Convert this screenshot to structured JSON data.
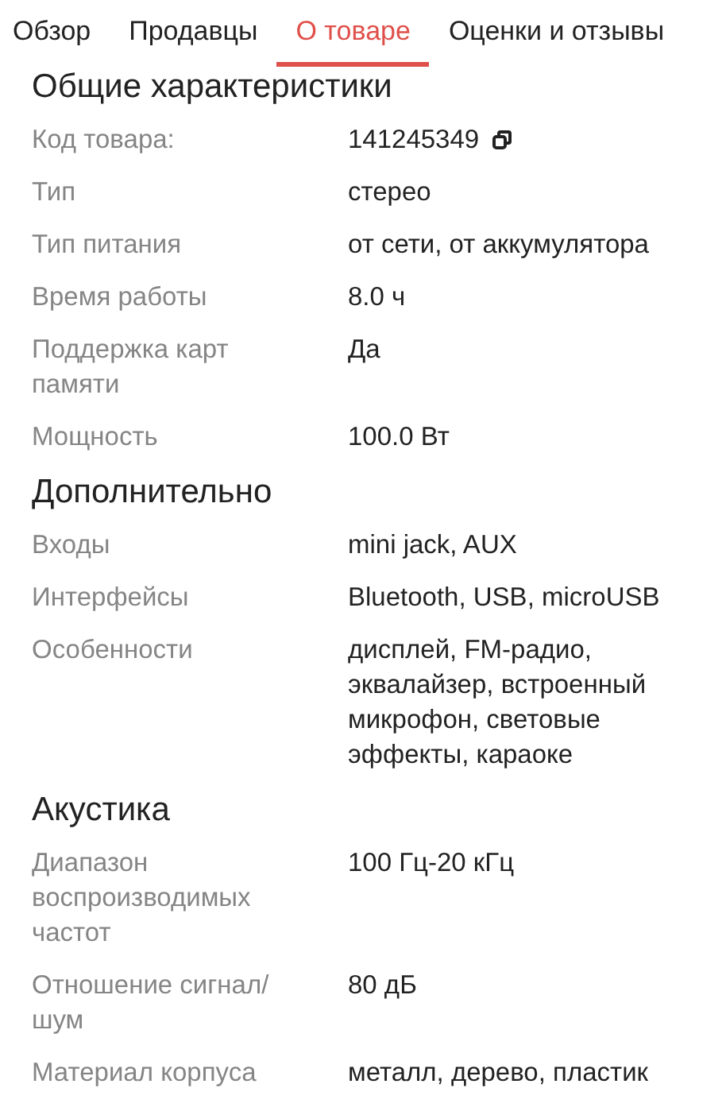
{
  "tabs": [
    {
      "label": "Обзор",
      "selected": false
    },
    {
      "label": "Продавцы",
      "selected": false
    },
    {
      "label": "О товаре",
      "selected": true
    },
    {
      "label": "Оценки и отзывы",
      "selected": false
    }
  ],
  "sections": [
    {
      "title": "Общие характеристики",
      "rows": [
        {
          "label": "Код товара:",
          "value": "141245349",
          "copy_button": true
        },
        {
          "label": "Тип",
          "value": "стерео",
          "copy_button": false
        },
        {
          "label": "Тип питания",
          "value": "от сети, от аккумулятора",
          "copy_button": false
        },
        {
          "label": "Время работы",
          "value": "8.0 ч",
          "copy_button": false
        },
        {
          "label": "Поддержка карт памяти",
          "value": "Да",
          "copy_button": false
        },
        {
          "label": "Мощность",
          "value": "100.0 Вт",
          "copy_button": false
        }
      ]
    },
    {
      "title": "Дополнительно",
      "rows": [
        {
          "label": "Входы",
          "value": "mini jack, AUX",
          "copy_button": false
        },
        {
          "label": "Интерфейсы",
          "value": "Bluetooth, USB, microUSB",
          "copy_button": false
        },
        {
          "label": "Особенности",
          "value": "дисплей, FM-радио, эквалайзер, встроенный микрофон, световые эффекты, караоке",
          "copy_button": false
        }
      ]
    },
    {
      "title": "Акустика",
      "rows": [
        {
          "label": "Диапазон воспроизводимых частот",
          "value": "100 Гц-20 кГц",
          "copy_button": false
        },
        {
          "label": "Отношение сигнал/шум",
          "value": "80 дБ",
          "copy_button": false
        },
        {
          "label": "Материал корпуса",
          "value": "металл, дерево, пластик",
          "copy_button": false
        }
      ]
    }
  ]
}
